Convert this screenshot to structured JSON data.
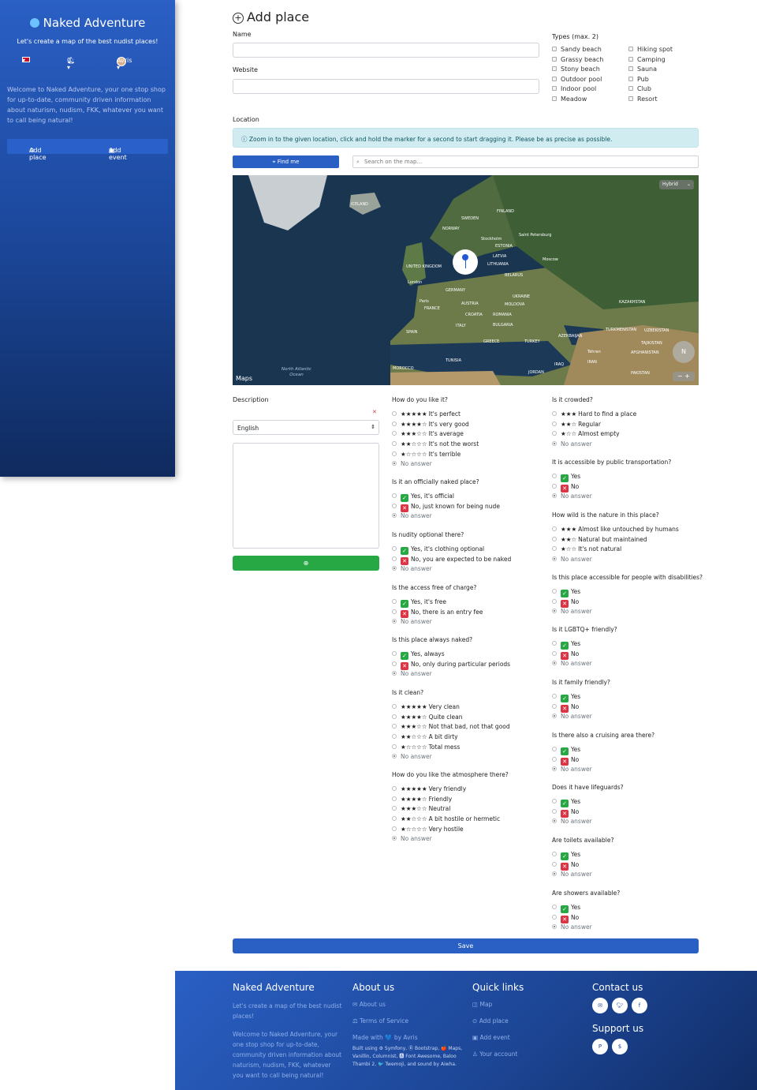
{
  "sidebar": {
    "brand": "Naked Adventure",
    "tagline": "Let's create a map of the best nudist places!",
    "lang_caret": "▾",
    "notif_count": "0 ▾",
    "user": "Avris ▾",
    "welcome": "Welcome to Naked Adventure, your one stop shop for up-to-date, community driven information about naturism, nudism, FKK, whatever you want to call being natural!",
    "add_place": "Add place",
    "add_event": "Add event"
  },
  "page": {
    "title": "Add place",
    "name_label": "Name",
    "website_label": "Website",
    "types_label": "Types (max. 2)",
    "types_left": [
      "Sandy beach",
      "Grassy beach",
      "Stony beach",
      "Outdoor pool",
      "Indoor pool",
      "Meadow"
    ],
    "types_right": [
      "Hiking spot",
      "Camping",
      "Sauna",
      "Pub",
      "Club",
      "Resort"
    ],
    "location_label": "Location",
    "location_hint": "Zoom in to the given location, click and hold the marker for a second to start dragging it. Please be as precise as possible.",
    "find_me": "Find me",
    "search_placeholder": "Search on the map...",
    "description_label": "Description",
    "language": "English",
    "save": "Save"
  },
  "map": {
    "type": "Hybrid",
    "brand": "Maps",
    "ocean": "North Atlantic Ocean",
    "compass": "N",
    "labels": [
      "ICELAND",
      "SWEDEN",
      "FINLAND",
      "NORWAY",
      "Stockholm",
      "Saint Petersburg",
      "ESTONIA",
      "LATVIA",
      "LITHUANIA",
      "Moscow",
      "UNITED KINGDOM",
      "BELARUS",
      "London",
      "GERMANY",
      "UKRAINE",
      "Paris",
      "FRANCE",
      "AUSTRIA",
      "MOLDOVA",
      "CROATIA",
      "ROMANIA",
      "KAZAKHSTAN",
      "ITALY",
      "BULGARIA",
      "SPAIN",
      "GREECE",
      "TURKEY",
      "AZERBAIJAN",
      "TURKMENISTAN",
      "UZBEKISTAN",
      "TAJIKISTAN",
      "TUNISIA",
      "IRAQ",
      "IRAN",
      "AFGHANISTAN",
      "MOROCCO",
      "PAKISTAN",
      "JORDAN",
      "Tehran"
    ]
  },
  "questions_middle": [
    {
      "q": "How do you like it?",
      "opts": [
        [
          "★★★★★",
          "It's perfect"
        ],
        [
          "★★★★☆",
          "It's very good"
        ],
        [
          "★★★☆☆",
          "It's average"
        ],
        [
          "★★☆☆☆",
          "It's not the worst"
        ],
        [
          "★☆☆☆☆",
          "It's terrible"
        ]
      ]
    },
    {
      "q": "Is it an officially naked place?",
      "yesno": [
        "Yes, it's official",
        "No, just known for being nude"
      ]
    },
    {
      "q": "Is nudity optional there?",
      "yesno": [
        "Yes, it's clothing optional",
        "No, you are expected to be naked"
      ]
    },
    {
      "q": "Is the access free of charge?",
      "yesno": [
        "Yes, it's free",
        "No, there is an entry fee"
      ]
    },
    {
      "q": "Is this place always naked?",
      "yesno": [
        "Yes, always",
        "No, only during particular periods"
      ]
    },
    {
      "q": "Is it clean?",
      "opts": [
        [
          "★★★★★",
          "Very clean"
        ],
        [
          "★★★★☆",
          "Quite clean"
        ],
        [
          "★★★☆☆",
          "Not that bad, not that good"
        ],
        [
          "★★☆☆☆",
          "A bit dirty"
        ],
        [
          "★☆☆☆☆",
          "Total mess"
        ]
      ]
    },
    {
      "q": "How do you like the atmosphere there?",
      "opts": [
        [
          "★★★★★",
          "Very friendly"
        ],
        [
          "★★★★☆",
          "Friendly"
        ],
        [
          "★★★☆☆",
          "Neutral"
        ],
        [
          "★★☆☆☆",
          "A bit hostile or hermetic"
        ],
        [
          "★☆☆☆☆",
          "Very hostile"
        ]
      ]
    }
  ],
  "questions_right": [
    {
      "q": "Is it crowded?",
      "opts": [
        [
          "★★★",
          "Hard to find a place"
        ],
        [
          "★★☆",
          "Regular"
        ],
        [
          "★☆☆",
          "Almost empty"
        ]
      ]
    },
    {
      "q": "It is accessible by public transportation?",
      "yesno": [
        "Yes",
        "No"
      ]
    },
    {
      "q": "How wild is the nature in this place?",
      "opts": [
        [
          "★★★",
          "Almost like untouched by humans"
        ],
        [
          "★★☆",
          "Natural but maintained"
        ],
        [
          "★☆☆",
          "It's not natural"
        ]
      ]
    },
    {
      "q": "Is this place accessible for people with disabilities?",
      "yesno": [
        "Yes",
        "No"
      ]
    },
    {
      "q": "Is it LGBTQ+ friendly?",
      "yesno": [
        "Yes",
        "No"
      ]
    },
    {
      "q": "Is it family friendly?",
      "yesno": [
        "Yes",
        "No"
      ]
    },
    {
      "q": "Is there also a cruising area there?",
      "yesno": [
        "Yes",
        "No"
      ]
    },
    {
      "q": "Does it have lifeguards?",
      "yesno": [
        "Yes",
        "No"
      ]
    },
    {
      "q": "Are toilets available?",
      "yesno": [
        "Yes",
        "No"
      ]
    },
    {
      "q": "Are showers available?",
      "yesno": [
        "Yes",
        "No"
      ]
    }
  ],
  "no_answer": "No answer",
  "footer": {
    "brand": "Naked Adventure",
    "tagline": "Let's create a map of the best nudist places!",
    "welcome": "Welcome to Naked Adventure, your one stop shop for up-to-date, community driven information about naturism, nudism, FKK, whatever you want to call being natural!",
    "about_title": "About us",
    "about_links": [
      "About us",
      "Terms of Service"
    ],
    "made_with": "Made with 💙 by Avris",
    "built_using": "Built using ⚙ Symfony, Ⓑ Bootstrap, 🍎 Maps, Vanillin, Columnist, 🅰 Font Awesome, Baloo Thambi 2, 🐦 Twemoji, and sound by Aiwha.",
    "quick_title": "Quick links",
    "quick_links": [
      "Map",
      "Add place",
      "Add event",
      "Your account"
    ],
    "contact_title": "Contact us",
    "support_title": "Support us"
  }
}
